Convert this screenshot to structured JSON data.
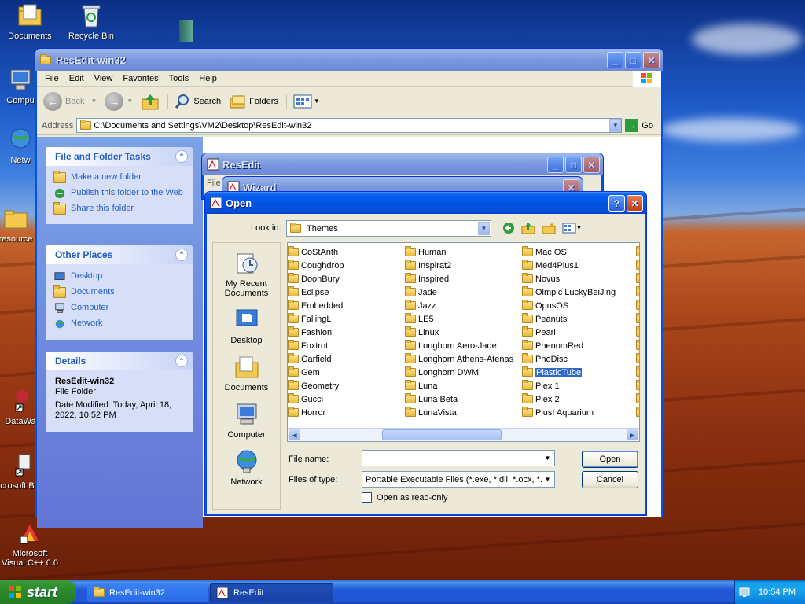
{
  "desktop": {
    "icons": [
      {
        "label": "Documents",
        "icon": "documents-folder-icon"
      },
      {
        "label": "Recycle Bin",
        "icon": "recycle-bin-icon"
      },
      {
        "label": "Compu",
        "icon": "computer-icon"
      },
      {
        "label": "Netw",
        "icon": "network-icon"
      },
      {
        "label": "resource",
        "icon": "folder-icon"
      },
      {
        "label": "DataWa",
        "icon": "shortcut-icon"
      },
      {
        "label": "Microsoft Basic",
        "icon": "shortcut-icon"
      },
      {
        "label": "Microsoft Visual C++ 6.0",
        "icon": "visual-cpp-icon"
      }
    ]
  },
  "explorer": {
    "title": "ResEdit-win32",
    "menu": [
      "File",
      "Edit",
      "View",
      "Favorites",
      "Tools",
      "Help"
    ],
    "toolbar": {
      "back": "Back",
      "search": "Search",
      "folders": "Folders"
    },
    "address_label": "Address",
    "address_value": "C:\\Documents and Settings\\VM2\\Desktop\\ResEdit-win32",
    "go_label": "Go",
    "tasks": {
      "file_folder_title": "File and Folder Tasks",
      "file_folder_items": [
        "Make a new folder",
        "Publish this folder to the Web",
        "Share this folder"
      ],
      "other_places_title": "Other Places",
      "other_places_items": [
        "Desktop",
        "Documents",
        "Computer",
        "Network"
      ],
      "details_title": "Details",
      "details_name": "ResEdit-win32",
      "details_type": "File Folder",
      "details_modified": "Date Modified: Today, April 18, 2022, 10:52 PM"
    }
  },
  "resedit": {
    "title": "ResEdit",
    "menu_stub": "File"
  },
  "wizard": {
    "title": "Wizard"
  },
  "open_dialog": {
    "title": "Open",
    "look_in_label": "Look in:",
    "look_in_value": "Themes",
    "places": [
      "My Recent Documents",
      "Desktop",
      "Documents",
      "Computer",
      "Network"
    ],
    "columns": [
      [
        "CoStAnth",
        "Coughdrop",
        "DoonBury",
        "Eclipse",
        "Embedded",
        "FallingL",
        "Fashion",
        "Foxtrot",
        "Garfield",
        "Gem",
        "Geometry",
        "Gucci",
        "Horror"
      ],
      [
        "Human",
        "Inspirat2",
        "Inspired",
        "Jade",
        "Jazz",
        "LE5",
        "Linux",
        "Longhorn Aero-Jade",
        "Longhorn Athens-Atenas",
        "Longhorn DWM",
        "Luna",
        "Luna Beta",
        "LunaVista"
      ],
      [
        "Mac OS",
        "Med4Plus1",
        "Novus",
        "Olmpic LuckyBeiJing",
        "OpusOS",
        "Peanuts",
        "Pearl",
        "PhenomRed",
        "PhoDisc",
        "PlasticTube",
        "Plex 1",
        "Plex 2",
        "Plus! Aquarium"
      ]
    ],
    "selected": "PlasticTube",
    "file_name_label": "File name:",
    "file_name_value": "",
    "file_type_label": "Files of type:",
    "file_type_value": "Portable Executable Files (*.exe, *.dll, *.ocx, *.m",
    "readonly_label": "Open as read-only",
    "open_button": "Open",
    "cancel_button": "Cancel"
  },
  "taskbar": {
    "start": "start",
    "tasks": [
      "ResEdit-win32",
      "ResEdit"
    ],
    "clock": "10:54 PM"
  }
}
